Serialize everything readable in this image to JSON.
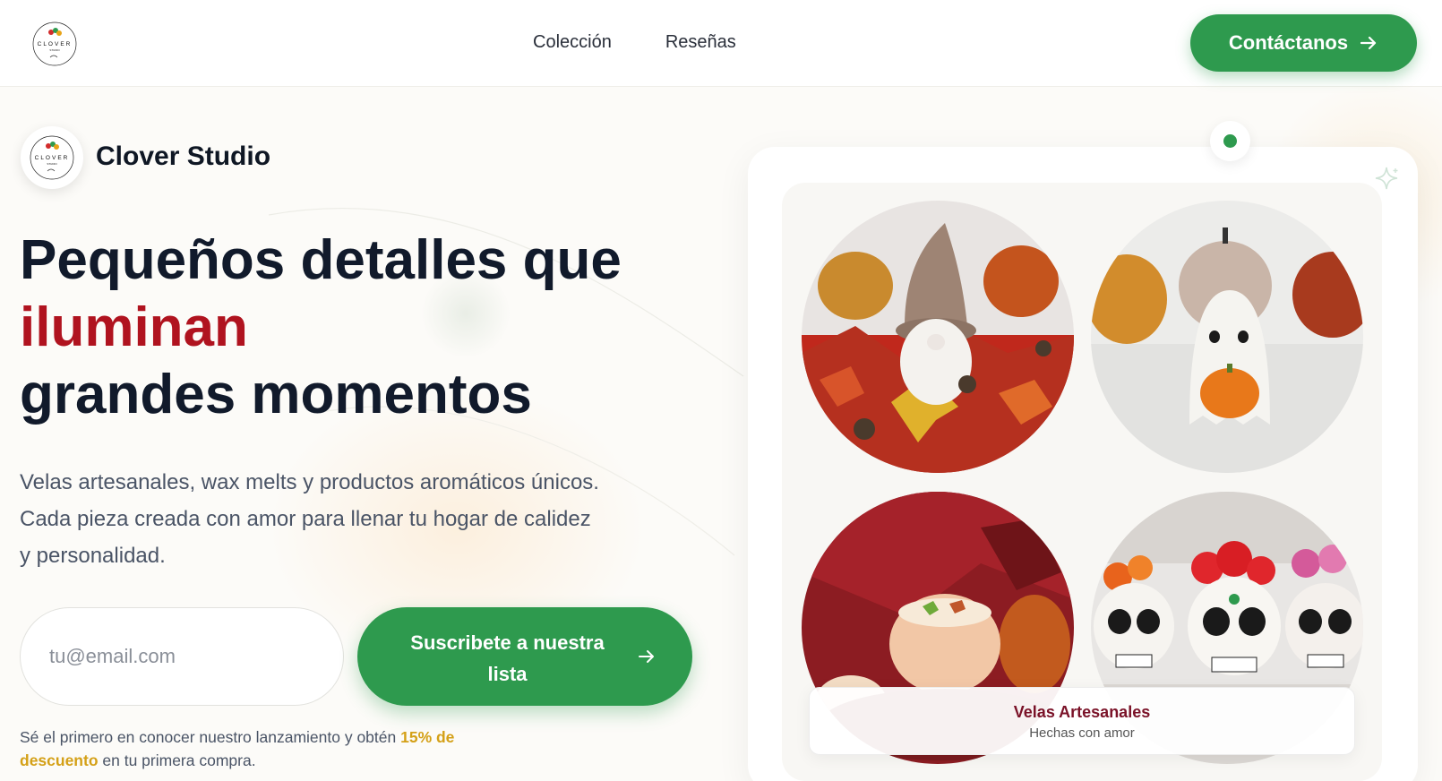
{
  "nav": {
    "logo_text": "CLOVER STUDIO",
    "links": [
      "Colección",
      "Reseñas"
    ],
    "cta_label": "Contáctanos"
  },
  "brand": {
    "name": "Clover Studio"
  },
  "hero": {
    "title_line1": "Pequeños detalles que",
    "title_accent": "iluminan",
    "title_line3": "grandes momentos",
    "description": "Velas artesanales, wax melts y productos aromáticos únicos. Cada pieza creada con amor para llenar tu hogar de calidez y personalidad."
  },
  "subscribe": {
    "email_placeholder": "tu@email.com",
    "button_label": "Suscribete a nuestra lista",
    "disclaimer_before": "Sé el primero en conocer nuestro lanzamiento y obtén ",
    "disclaimer_highlight": "15% de descuento",
    "disclaimer_after": " en tu primera compra."
  },
  "gallery": {
    "caption_title": "Velas Artesanales",
    "caption_subtitle": "Hechas con amor",
    "photos": [
      "gnome-candle-photo",
      "ghost-candle-photo",
      "pumpkin-candle-photo",
      "sugar-skull-candles-photo"
    ]
  },
  "colors": {
    "primary_green": "#2e9a4e",
    "accent_red": "#b0131f",
    "highlight_gold": "#d4a017",
    "caption_maroon": "#7a1228"
  }
}
